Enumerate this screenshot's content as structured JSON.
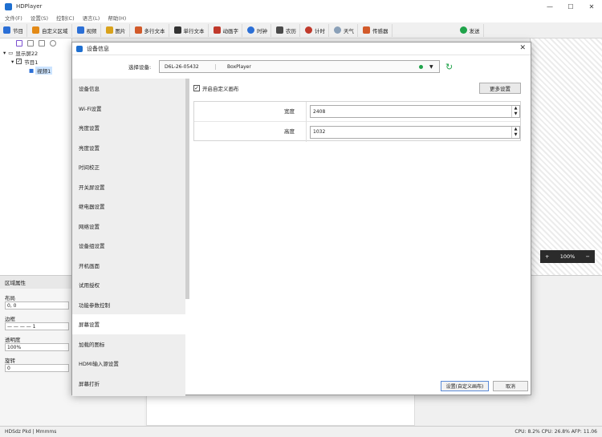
{
  "app": {
    "title": "HDPlayer",
    "window_controls": [
      "—",
      "☐",
      "✕"
    ]
  },
  "menu": [
    "文件(F)",
    "设置(S)",
    "控制(C)",
    "语言(L)",
    "帮助(H)"
  ],
  "toolbar": [
    {
      "label": "节目",
      "color": "#2b6fd6"
    },
    {
      "label": "自定义区域",
      "color": "#e38a17"
    },
    {
      "label": "视频",
      "color": "#2b6fd6"
    },
    {
      "label": "图片",
      "color": "#d9a21b"
    },
    {
      "label": "多行文本",
      "color": "#d25a2a"
    },
    {
      "label": "单行文本",
      "color": "#333333"
    },
    {
      "label": "动画字",
      "color": "#c0392b"
    },
    {
      "label": "时钟",
      "color": "#2b6fd6"
    },
    {
      "label": "农历",
      "color": "#4a4a4a"
    },
    {
      "label": "计时",
      "color": "#c0392b"
    },
    {
      "label": "天气",
      "color": "#8aa0b8"
    },
    {
      "label": "传感器",
      "color": "#d25a2a"
    },
    {
      "label": "发送",
      "color": "#1fa34a"
    }
  ],
  "tree": {
    "screen": "显示屏22",
    "program": "节目1",
    "video": "视频1"
  },
  "canvas": {
    "zoom": "100%",
    "zoom_in": "+",
    "zoom_out": "−"
  },
  "properties": {
    "header": "区域属性",
    "layout_label": "布局",
    "layout_value": "0, 0",
    "border_label": "边框",
    "border_value": "— — — —   1",
    "opacity_label": "透明度",
    "opacity_value": "100%",
    "rotate_label": "旋转",
    "rotate_value": "0"
  },
  "statusbar": {
    "left": "HDSdz  Pkd  |  Mmmms",
    "right": "CPU: 8.2%   CPU: 26.8%   AFP: 11.06"
  },
  "dialog": {
    "title": "设备信息",
    "close": "✕",
    "device_label": "选择设备:",
    "device_id": "D6L-26-05432",
    "device_name": "BoxPlayer",
    "refresh": "↻",
    "nav": [
      "设备信息",
      "Wi-Fi设置",
      "亮度设置",
      "亮度设置",
      "时间校正",
      "开关屏设置",
      "继电器设置",
      "网络设置",
      "设备组设置",
      "开机画面",
      "试用授权",
      "功能参数控制",
      "屏幕设置",
      "加载的图标",
      "HDMI输入源设置",
      "屏幕打折"
    ],
    "active_nav_index": 12,
    "custom_canvas_label": "开启自定义画布",
    "custom_canvas_checked": true,
    "more_settings": "更多设置",
    "width_label": "宽度",
    "width_value": "2408",
    "height_label": "高度",
    "height_value": "1032",
    "apply_button": "设置(自定义画布)",
    "cancel_button": "取消"
  }
}
